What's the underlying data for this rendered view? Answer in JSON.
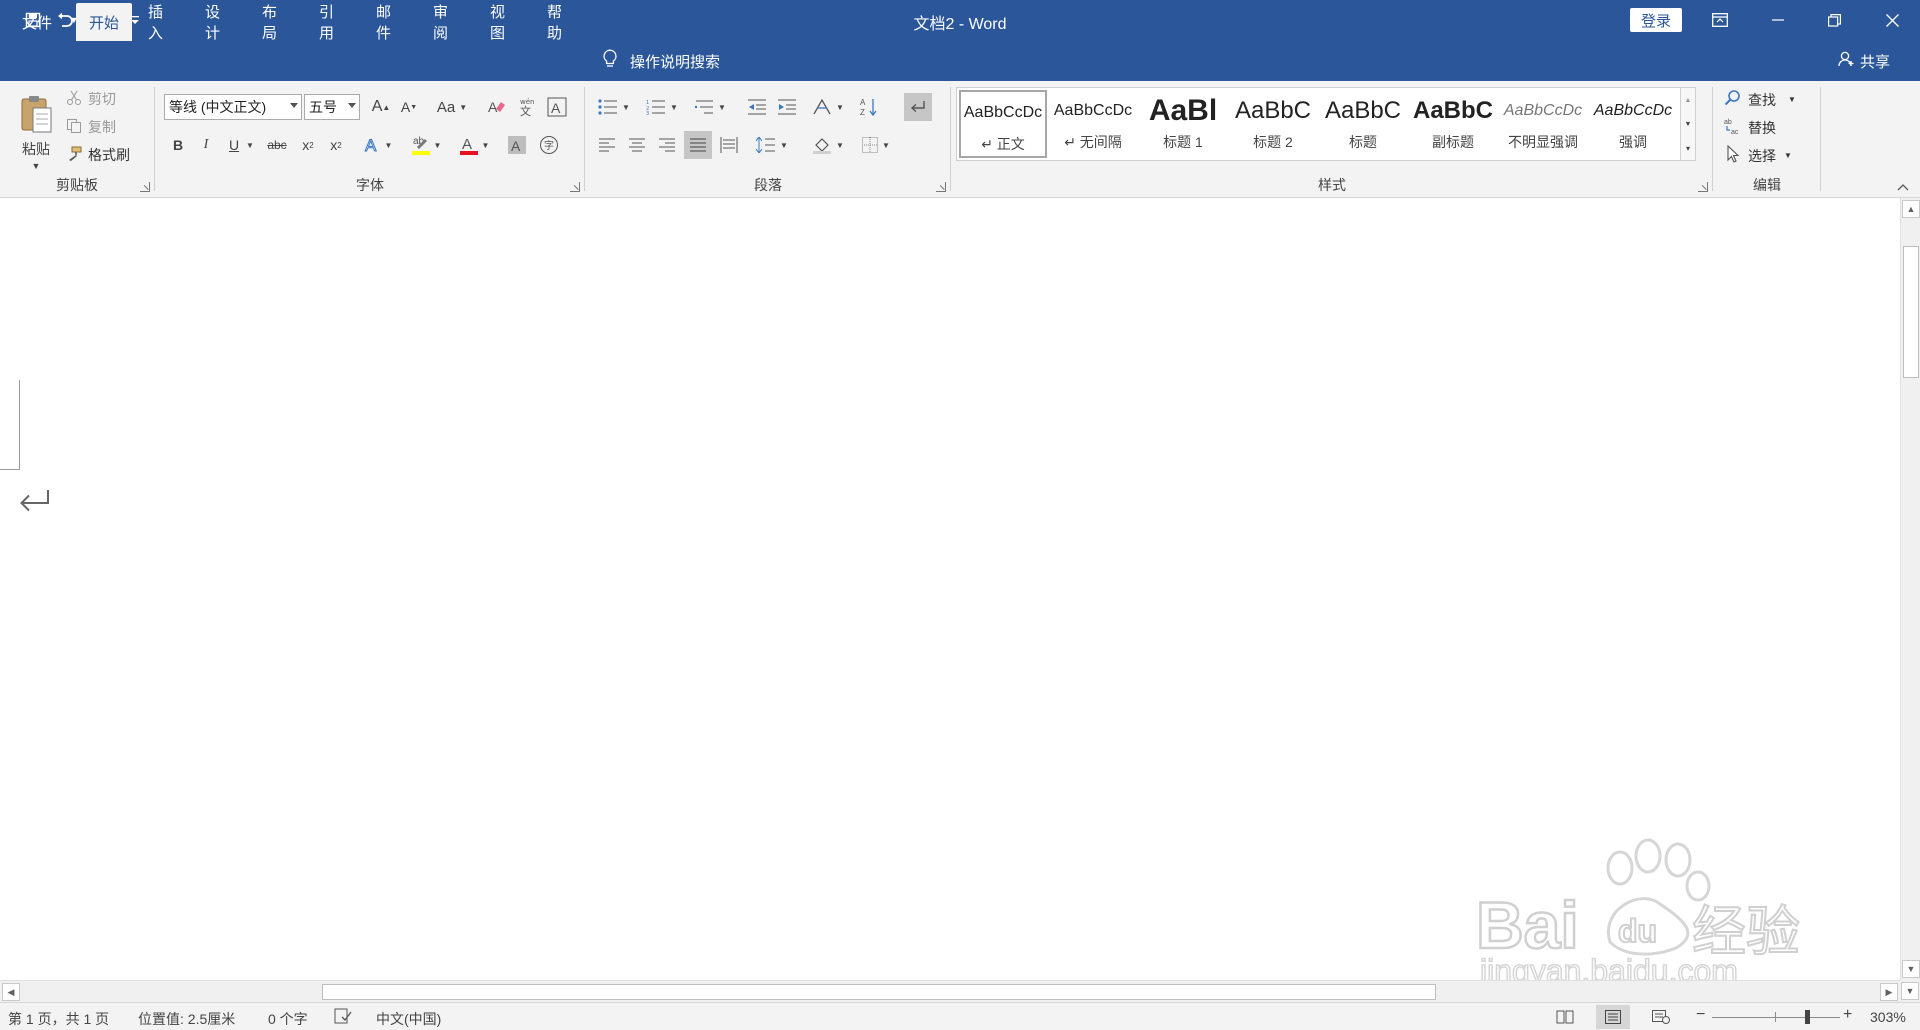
{
  "titlebar": {
    "title": "文档2  -  Word",
    "login": "登录"
  },
  "tabs": [
    {
      "label": "文件"
    },
    {
      "label": "开始"
    },
    {
      "label": "插入"
    },
    {
      "label": "设计"
    },
    {
      "label": "布局"
    },
    {
      "label": "引用"
    },
    {
      "label": "邮件"
    },
    {
      "label": "审阅"
    },
    {
      "label": "视图"
    },
    {
      "label": "帮助"
    }
  ],
  "tell_me": "操作说明搜索",
  "share": "共享",
  "clipboard": {
    "paste": "粘贴",
    "cut": "剪切",
    "copy": "复制",
    "format_painter": "格式刷",
    "group_label": "剪贴板"
  },
  "font": {
    "font_name": "等线 (中文正文)",
    "font_size": "五号",
    "change_case": "Aa",
    "group_label": "字体"
  },
  "paragraph": {
    "group_label": "段落"
  },
  "styles": {
    "group_label": "样式",
    "items": [
      {
        "sample": "AaBbCcDc",
        "name": "↵ 正文"
      },
      {
        "sample": "AaBbCcDc",
        "name": "↵ 无间隔"
      },
      {
        "sample": "AaBl",
        "name": "标题 1"
      },
      {
        "sample": "AaBbC",
        "name": "标题 2"
      },
      {
        "sample": "AaBbC",
        "name": "标题"
      },
      {
        "sample": "AaBbC",
        "name": "副标题"
      },
      {
        "sample": "AaBbCcDc",
        "name": "不明显强调"
      },
      {
        "sample": "AaBbCcDc",
        "name": "强调"
      }
    ]
  },
  "editing": {
    "find": "查找",
    "replace": "替换",
    "select": "选择",
    "group_label": "编辑"
  },
  "status": {
    "page": "第 1 页，共 1 页",
    "position": "位置值: 2.5厘米",
    "words": "0 个字",
    "language": "中文(中国)",
    "zoom": "303%",
    "zoom_minus": "−",
    "zoom_plus": "+"
  },
  "watermark": {
    "brand": "Bai du 经验",
    "url": "jingyan.baidu.com"
  },
  "colors": {
    "accent": "#2b579a",
    "ribbon_bg": "#f3f3f3",
    "font_color_bar": "#e81123",
    "highlight_bar": "#ffff00"
  }
}
